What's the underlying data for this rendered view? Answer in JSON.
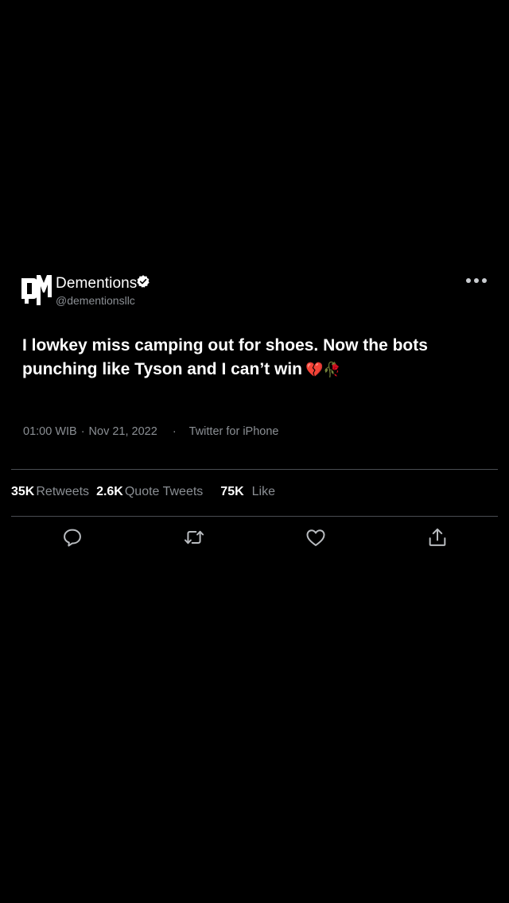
{
  "tweet": {
    "logo_text": "DM",
    "display_name": "Dementions",
    "verified": true,
    "handle": "@dementionsllc",
    "text": "I lowkey miss camping out for shoes. Now the bots punching like Tyson and I can’t win",
    "emoji": "💔🥀",
    "time": "01:00 WIB",
    "date": "Nov 21, 2022",
    "source": "Twitter for iPhone"
  },
  "stats": {
    "retweets_count": "35K",
    "retweets_label": "Retweets",
    "quotes_count": "2.6K",
    "quotes_label": "Quote Tweets",
    "likes_count": "75K",
    "likes_label": "Like"
  },
  "actions": [
    {
      "icon": "reply-icon"
    },
    {
      "icon": "retweet-icon"
    },
    {
      "icon": "like-icon"
    },
    {
      "icon": "share-icon"
    }
  ],
  "colors": {
    "background": "#000000",
    "text": "#ffffff",
    "secondary": "#8b8f94",
    "divider": "#4a4d52"
  }
}
